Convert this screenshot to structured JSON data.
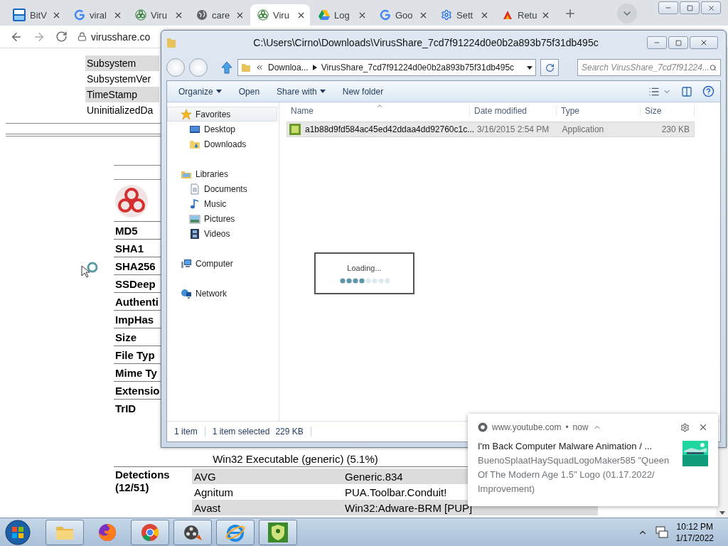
{
  "browser": {
    "tabs": [
      {
        "kind": "bitview",
        "title": "BitV",
        "selected": false
      },
      {
        "kind": "google",
        "title": "viral",
        "selected": false
      },
      {
        "kind": "biohazard",
        "title": "Viru",
        "selected": false
      },
      {
        "kind": "globe",
        "title": "care",
        "selected": false
      },
      {
        "kind": "biohazard",
        "title": "Viru",
        "selected": true
      },
      {
        "kind": "drive",
        "title": "Log",
        "selected": false
      },
      {
        "kind": "google",
        "title": "Goo",
        "selected": false
      },
      {
        "kind": "gear",
        "title": "Sett",
        "selected": false
      },
      {
        "kind": "red",
        "title": "Retu",
        "selected": false
      }
    ],
    "address": "virusshare.co"
  },
  "page": {
    "pe_rows": [
      {
        "label": "Subsystem",
        "shaded": true
      },
      {
        "label": "SubsystemVer",
        "shaded": false
      },
      {
        "label": "TimeStamp",
        "shaded": true
      },
      {
        "label": "UninitializedDa",
        "shaded": false
      }
    ],
    "hash_labels": [
      "MD5",
      "SHA1",
      "SHA256",
      "SSDeep",
      "Authenti",
      "ImpHas",
      "Size",
      "File Typ",
      "Mime Ty",
      "Extensio",
      "TrID"
    ],
    "trid_line": "Win32 Executable (generic) (5.1%)",
    "detections": {
      "label": "Detections",
      "count": "(12/51)",
      "rows": [
        {
          "engine": "AVG",
          "result": "Generic.834",
          "shaded": true
        },
        {
          "engine": "Agnitum",
          "result": "PUA.Toolbar.Conduit!",
          "shaded": false
        },
        {
          "engine": "Avast",
          "result": "Win32:Adware-BRM [PUP]",
          "shaded": true
        }
      ]
    }
  },
  "explorer": {
    "title": "C:\\Users\\Cirno\\Downloads\\VirusShare_7cd7f91224d0e0b2a893b75f31db495c",
    "breadcrumb": [
      "Downloa...",
      "VirusShare_7cd7f91224d0e0b2a893b75f31db495c"
    ],
    "search_placeholder": "Search VirusShare_7cd7f91224...",
    "toolbar": [
      {
        "label": "Organize",
        "dropdown": true
      },
      {
        "label": "Open",
        "dropdown": false
      },
      {
        "label": "Share with",
        "dropdown": true
      },
      {
        "label": "New folder",
        "dropdown": false
      }
    ],
    "tree": [
      {
        "kind": "star",
        "label": "Favorites",
        "selected": true,
        "children": [
          {
            "kind": "desktop",
            "label": "Desktop",
            "selected": false
          },
          {
            "kind": "downloads",
            "label": "Downloads",
            "selected": false
          }
        ]
      },
      {
        "kind": "library",
        "label": "Libraries",
        "selected": false,
        "children": [
          {
            "kind": "documents",
            "label": "Documents",
            "selected": false
          },
          {
            "kind": "music",
            "label": "Music",
            "selected": false
          },
          {
            "kind": "pictures",
            "label": "Pictures",
            "selected": false
          },
          {
            "kind": "videos",
            "label": "Videos",
            "selected": false
          }
        ]
      },
      {
        "kind": "computer",
        "label": "Computer",
        "selected": false
      },
      {
        "kind": "network",
        "label": "Network",
        "selected": false
      }
    ],
    "columns": [
      "Name",
      "Date modified",
      "Type",
      "Size"
    ],
    "files": [
      {
        "name": "a1b88d9fd584ac45ed42ddaa4dd92760c1c...",
        "date": "3/16/2015 2:54 PM",
        "type": "Application",
        "size": "230 KB",
        "selected": true
      }
    ],
    "loading": {
      "text": "Loading..."
    },
    "status": {
      "count": "1 item",
      "selection": "1 item selected",
      "size": "229 KB"
    }
  },
  "notification": {
    "site": "www.youtube.com",
    "dot": "•",
    "time": "now",
    "title": "I'm Back Computer Malware Animation / ...",
    "body": "BuenoSplaatHaySquadLogoMaker585 \"Queen Of The Modern Age 1.5\" Logo (01.17.2022/ Improvement)"
  },
  "taskbar": {
    "apps": [
      {
        "kind": "folder",
        "running": true
      },
      {
        "kind": "firefox",
        "running": false
      },
      {
        "kind": "chrome",
        "running": true
      },
      {
        "kind": "media",
        "running": true
      },
      {
        "kind": "ie",
        "running": true
      },
      {
        "kind": "shield",
        "running": true
      }
    ],
    "time": "10:12 PM",
    "date": "1/17/2022"
  }
}
